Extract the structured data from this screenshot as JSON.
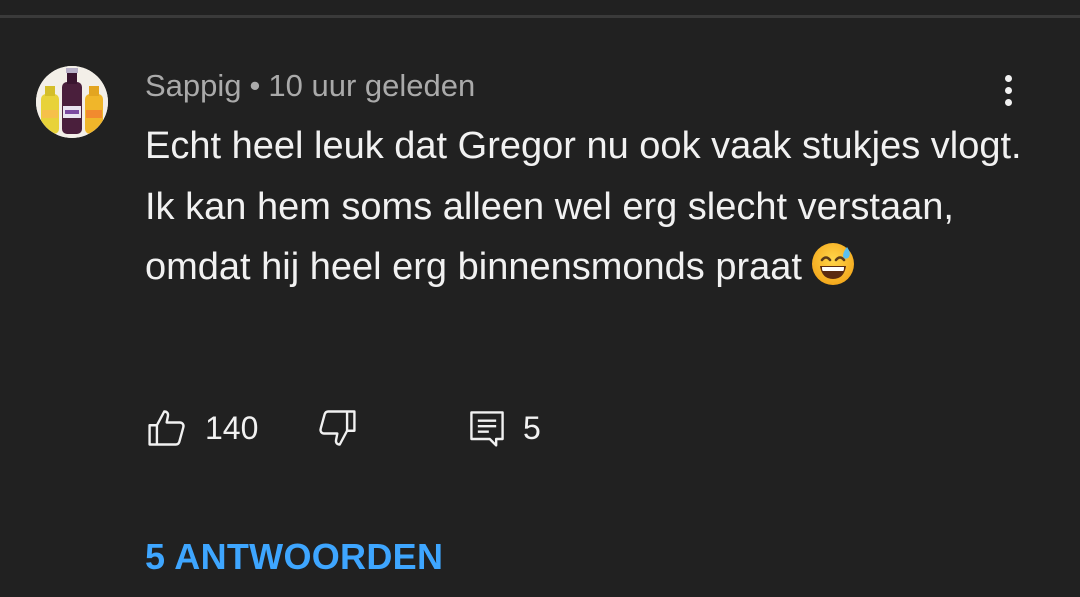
{
  "comment": {
    "author": "Sappig",
    "separator": "•",
    "timestamp": "10 uur geleden",
    "text": "Echt heel leuk dat Gregor nu ook vaak stukjes vlogt. Ik kan hem soms alleen wel erg slecht verstaan, omdat hij heel erg binnensmonds praat",
    "emoji": "grinning-face-with-sweat",
    "likes": "140",
    "reply_count": "5",
    "replies_link": "5 ANTWOORDEN"
  },
  "icons": {
    "like": "thumbs-up-icon",
    "dislike": "thumbs-down-icon",
    "reply": "comment-icon",
    "menu": "more-vert-icon"
  },
  "colors": {
    "background": "#212121",
    "text_primary": "#f1f1f1",
    "text_secondary": "#aaaaaa",
    "link": "#3ea6ff"
  }
}
